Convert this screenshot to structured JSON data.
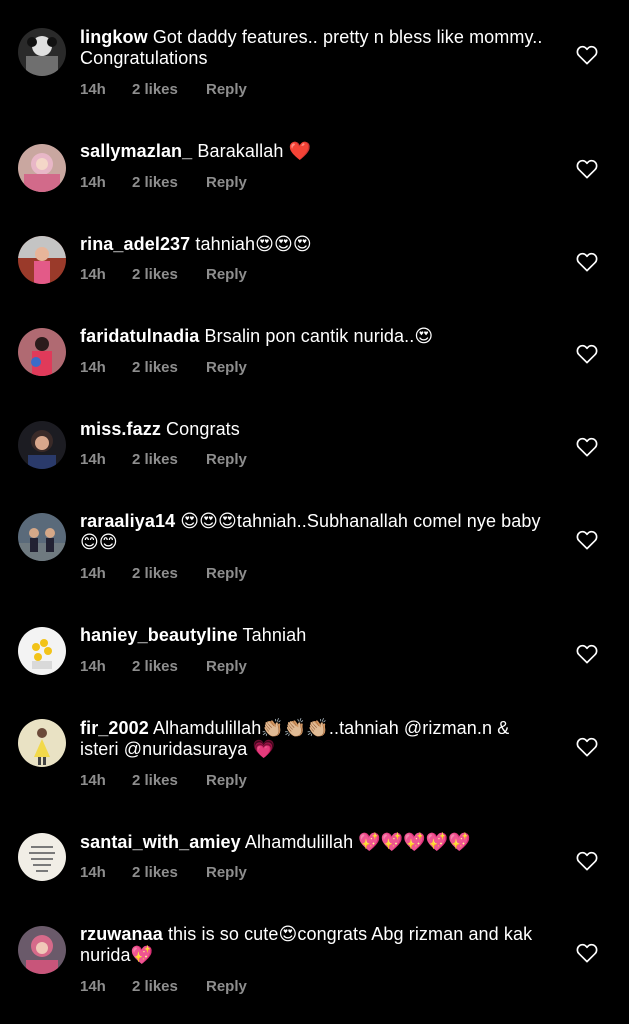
{
  "colors": {
    "background": "#000000",
    "text": "#ffffff",
    "meta": "#8e8e8e"
  },
  "comments": [
    {
      "username": "lingkow",
      "text": "Got daddy features.. pretty n bless like mommy.. Congratulations",
      "time": "14h",
      "likes": "2 likes",
      "reply": "Reply"
    },
    {
      "username": "sallymazlan_",
      "text": "Barakallah ❤️",
      "time": "14h",
      "likes": "2 likes",
      "reply": "Reply"
    },
    {
      "username": "rina_adel237",
      "text": "tahniah😍😍😍",
      "time": "14h",
      "likes": "2 likes",
      "reply": "Reply"
    },
    {
      "username": "faridatulnadia",
      "text": "Brsalin pon cantik nurida..😍",
      "time": "14h",
      "likes": "2 likes",
      "reply": "Reply"
    },
    {
      "username": "miss.fazz",
      "text": "Congrats",
      "time": "14h",
      "likes": "2 likes",
      "reply": "Reply"
    },
    {
      "username": "raraaliya14",
      "text": "😍😍😍tahniah..Subhanallah comel nye baby😊😊",
      "time": "14h",
      "likes": "2 likes",
      "reply": "Reply"
    },
    {
      "username": "haniey_beautyline",
      "text": "Tahniah",
      "time": "14h",
      "likes": "2 likes",
      "reply": "Reply"
    },
    {
      "username": "fir_2002",
      "text": "Alhamdulillah👏🏼👏🏼👏🏼..tahniah @rizman.n & isteri @nuridasuraya 💗",
      "time": "14h",
      "likes": "2 likes",
      "reply": "Reply"
    },
    {
      "username": "santai_with_amiey",
      "text": "Alhamdulillah 💖💖💖💖💖",
      "time": "14h",
      "likes": "2 likes",
      "reply": "Reply"
    },
    {
      "username": "rzuwanaa",
      "text": "this is so cute😍congrats Abg rizman and kak nurida💖",
      "time": "14h",
      "likes": "2 likes",
      "reply": "Reply"
    }
  ],
  "icons": {
    "like": "heart-outline-icon"
  }
}
